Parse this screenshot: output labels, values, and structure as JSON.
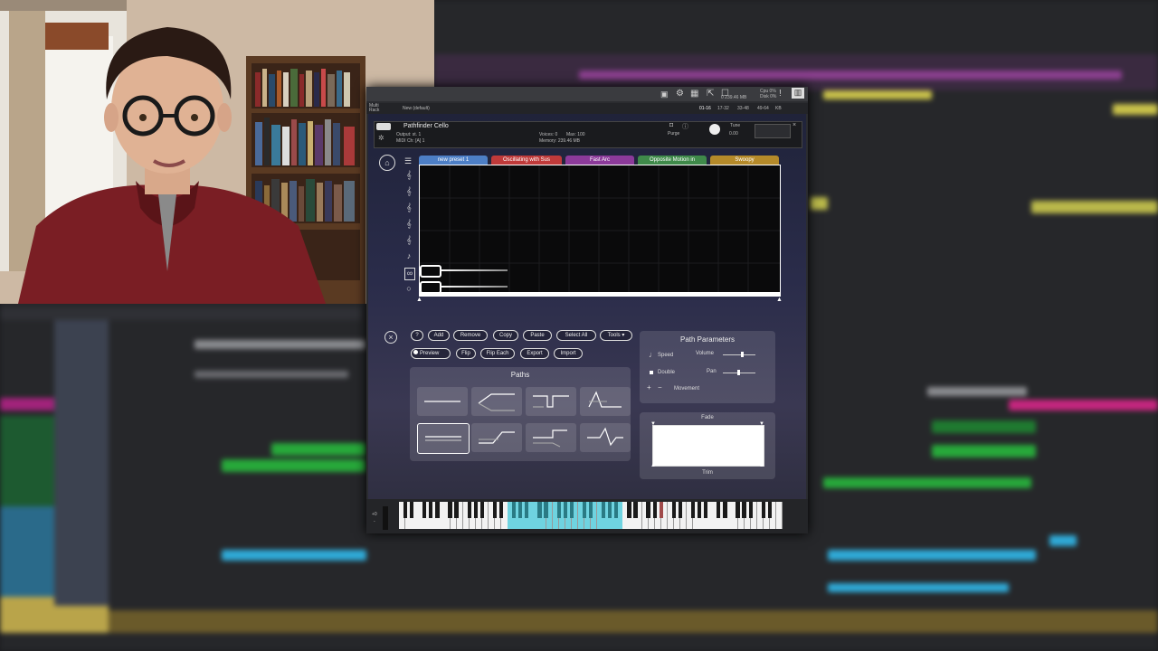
{
  "window": {
    "multi_rack": "Multi\nRack",
    "multi_title": "New (default)",
    "range_tabs": [
      "01-16",
      "17-32",
      "33-48",
      "49-64",
      "KB"
    ],
    "cpu": "Cpu 0%",
    "disk": "Disk 0%",
    "memory": "0 239.46 MB"
  },
  "instrument": {
    "name": "Pathfinder Cello",
    "output_label": "Output: st. 1",
    "midi_label": "MIDI Ch: [A] 1",
    "voices_label": "Voices: 0",
    "max_label": "Max: 100",
    "memory_label": "Memory: 239.46 MB",
    "purge_label": "Purge",
    "tune_label": "Tune",
    "tune_value": "0.00",
    "tabs": [
      {
        "label": "new preset 1",
        "color": "#4d7fc6"
      },
      {
        "label": "Oscillating with Sus",
        "color": "#c03a3a"
      },
      {
        "label": "Fast Arc",
        "color": "#8c3a9a"
      },
      {
        "label": "Opposite Motion in",
        "color": "#3f8a4a"
      },
      {
        "label": "Swoopy",
        "color": "#b58a2a"
      }
    ]
  },
  "toolbar": {
    "help_label": "?",
    "add_label": "Add",
    "remove_label": "Remove",
    "copy_label": "Copy",
    "paste_label": "Paste",
    "select_all_label": "Select All",
    "tools_label": "Tools ▾",
    "preview_label": "Preview",
    "flip_label": "Flip",
    "flip_each_label": "Flip Each",
    "export_label": "Export",
    "import_label": "Import"
  },
  "paths_panel": {
    "title": "Paths"
  },
  "path_parameters": {
    "title": "Path Parameters",
    "speed_label": "Speed",
    "double_label": "Double",
    "volume_label": "Volume",
    "pan_label": "Pan",
    "movement_label": "Movement",
    "plus": "+",
    "minus": "−"
  },
  "fade_panel": {
    "fade_label": "Fade",
    "trim_label": "Trim"
  },
  "keyboard": {
    "octave_labels": [
      "+0",
      "-"
    ]
  },
  "colors": {
    "accent_blue": "#6fd3e0",
    "tab_blue": "#4d7fc6"
  }
}
